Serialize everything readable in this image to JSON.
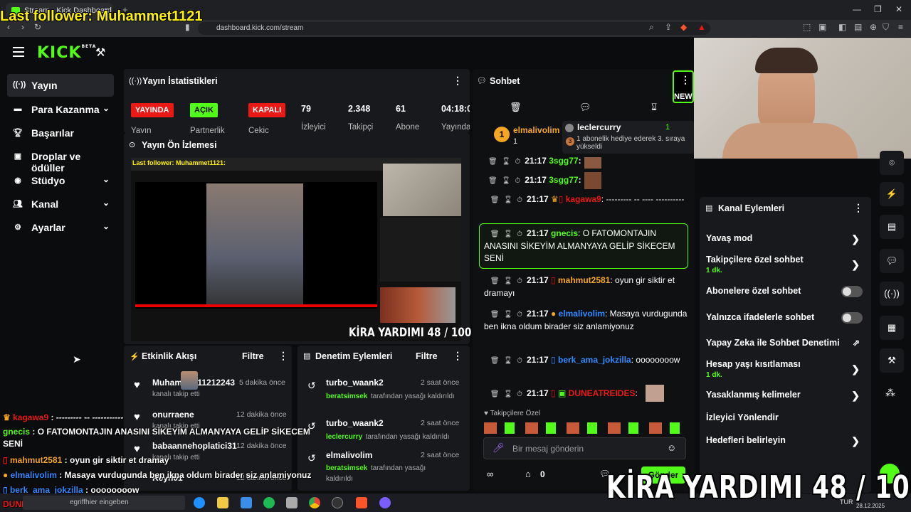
{
  "browser": {
    "tab_title": "Stream - Kick Dashboard",
    "url": "dashboard.kick.com/stream",
    "new_tab": "+",
    "close_tab": "x"
  },
  "overlay": {
    "follower": "Last follower: Muhammet1121",
    "kira": "KİRA YARDIMI  48 / 100"
  },
  "header": {
    "logo": "KICK",
    "logo_beta": "BETA"
  },
  "sidebar": {
    "items": [
      {
        "label": "Yayın",
        "icon": "broadcast-icon"
      },
      {
        "label": "Para Kazanma",
        "icon": "money-icon"
      },
      {
        "label": "Başarılar",
        "icon": "trophy-icon"
      },
      {
        "label": "Droplar ve ödüller",
        "icon": "gift-icon"
      },
      {
        "label": "Stüdyo",
        "icon": "studio-icon"
      },
      {
        "label": "Kanal",
        "icon": "users-icon"
      },
      {
        "label": "Ayarlar",
        "icon": "gear-icon"
      }
    ]
  },
  "stats": {
    "title": "Yayın İstatistikleri",
    "chips": [
      {
        "label": "YAYINDA",
        "sub": "Yayın",
        "bg": "#e91916",
        "fg": "#ffffff"
      },
      {
        "label": "AÇIK",
        "sub": "Partnerlik",
        "bg": "#53fc18",
        "fg": "#000000"
      },
      {
        "label": "KAPALI",
        "sub": "Çekiç",
        "bg": "#e91916",
        "fg": "#ffffff"
      }
    ],
    "numbers": [
      {
        "value": "79",
        "label": "İzleyici"
      },
      {
        "value": "2.348",
        "label": "Takipçi"
      },
      {
        "value": "61",
        "label": "Abone"
      },
      {
        "value": "04:18:0",
        "label": "Yayında"
      }
    ]
  },
  "preview": {
    "title": "Yayın Ön İzlemesi",
    "inner_follower": "Last follower: Muhammet1121:",
    "inner_kira": "KİRA YARDIMI  48 / 100"
  },
  "activity": {
    "title": "Etkinlik Akışı",
    "filter": "Filtre",
    "items": [
      {
        "name": "Muhammet11212243",
        "sub": "kanalı takip etti",
        "time": "5 dakika önce"
      },
      {
        "name": "onurraene",
        "sub": "kanalı takip etti",
        "time": "12 dakika önce"
      },
      {
        "name": "babaannehoplatici31",
        "sub": "kanalı takip etti",
        "time": "12 dakika önce"
      },
      {
        "name": "Reyn01",
        "sub": "",
        "time": "12 dakika önce"
      }
    ]
  },
  "moderation": {
    "title": "Denetim Eylemleri",
    "filter": "Filtre",
    "items": [
      {
        "user": "turbo_waank2",
        "by": "beratsimsek",
        "text": "tarafından yasağı kaldırıldı",
        "time": "2 saat önce"
      },
      {
        "user": "turbo_waank2",
        "by": "leclercurry",
        "text": "tarafından yasağı kaldırıldı",
        "time": "2 saat önce"
      },
      {
        "user": "elmalivolim",
        "by": "beratsimsek",
        "text": "tarafından yasağı kaldırıldı",
        "time": "2 saat önce"
      }
    ]
  },
  "chat": {
    "title": "Sohbet",
    "new_badge": "NEW",
    "top_gifter": {
      "rank": "1",
      "name": "elmalivolim",
      "count": "1"
    },
    "gift_card": {
      "rank": "3",
      "name": "leclercurry",
      "count": "1",
      "text": "1 abonelik hediye ederek 3. sıraya yükseldi"
    },
    "messages": [
      {
        "time": "21:17",
        "user": "3sgg77",
        "color": "#53fc18",
        "text": ""
      },
      {
        "time": "21:17",
        "user": "3sgg77",
        "color": "#53fc18",
        "text": ""
      },
      {
        "time": "21:17",
        "user": "kagawa9",
        "color": "#e91916",
        "text": "--------- -- ---- ----------"
      },
      {
        "time": "21:17",
        "user": "gnecis",
        "color": "#53fc18",
        "text": "O FATOMONTAJIN ANASINI SİKEYİM ALMANYAYA GELİP SİKECEM SENİ"
      },
      {
        "time": "21:17",
        "user": "mahmut2581",
        "color": "#f5a623",
        "text": "oyun gir siktir et dramayı"
      },
      {
        "time": "21:17",
        "user": "elmalivolim",
        "color": "#2f8cff",
        "text": "Masaya vurdugunda ben ikna oldum birader siz anlamiyonuz"
      },
      {
        "time": "21:17",
        "user": "berk_ama_jokzilla",
        "color": "#2f8cff",
        "text": "oooooooow"
      },
      {
        "time": "21:17",
        "user": "DUNEATREIDES",
        "color": "#e91916",
        "text": ""
      }
    ],
    "followers_only_label": "Takipçilere Özel",
    "input_placeholder": "Bir mesaj gönderin",
    "points": "0",
    "send": "Gönder"
  },
  "channel_actions": {
    "title": "Kanal Eylemleri",
    "rows": [
      {
        "label": "Yavaş mod",
        "sub": "",
        "kind": "chevron"
      },
      {
        "label": "Takipçilere özel sohbet",
        "sub": "1 dk.",
        "kind": "chevron"
      },
      {
        "label": "Abonelere özel sohbet",
        "sub": "",
        "kind": "toggle"
      },
      {
        "label": "Yalnızca ifadelerle sohbet",
        "sub": "",
        "kind": "toggle"
      },
      {
        "label": "Yapay Zeka ile Sohbet Denetimi",
        "sub": "",
        "kind": "external"
      },
      {
        "label": "Hesap yaşı kısıtlaması",
        "sub": "1 dk.",
        "kind": "chevron"
      },
      {
        "label": "Yasaklanmış kelimeler",
        "sub": "",
        "kind": "chevron"
      },
      {
        "label": "İzleyici Yönlendir",
        "sub": "",
        "kind": "none"
      },
      {
        "label": "Hedefleri belirleyin",
        "sub": "",
        "kind": "chevron"
      }
    ]
  },
  "overlay_chat": [
    {
      "user": "kagawa9",
      "color": "#e91916",
      "text": "--------- -- -----------"
    },
    {
      "user": "gnecis",
      "color": "#53fc18",
      "text": "O FATOMONTAJIN ANASINI SİKEYİM ALMANYAYA GELİP SİKECEM"
    },
    {
      "user": "",
      "color": "#ffffff",
      "text": "SENİ"
    },
    {
      "user": "mahmut2581",
      "color": "#f5a623",
      "text": "oyun gir siktir et dramay"
    },
    {
      "user": "elmalivolim",
      "color": "#2f8cff",
      "text": "Masaya vurdugunda ben ikna oldum birader siz anlamiyonuz"
    },
    {
      "user": "berk_ama_jokzilla",
      "color": "#2f8cff",
      "text": "oooooooow"
    },
    {
      "user": "DUNEATREIDES",
      "color": "#e91916",
      "text": ""
    }
  ],
  "taskbar": {
    "search": "egriffhier eingeben",
    "lang": "TUR",
    "date": "28.12.2025"
  }
}
